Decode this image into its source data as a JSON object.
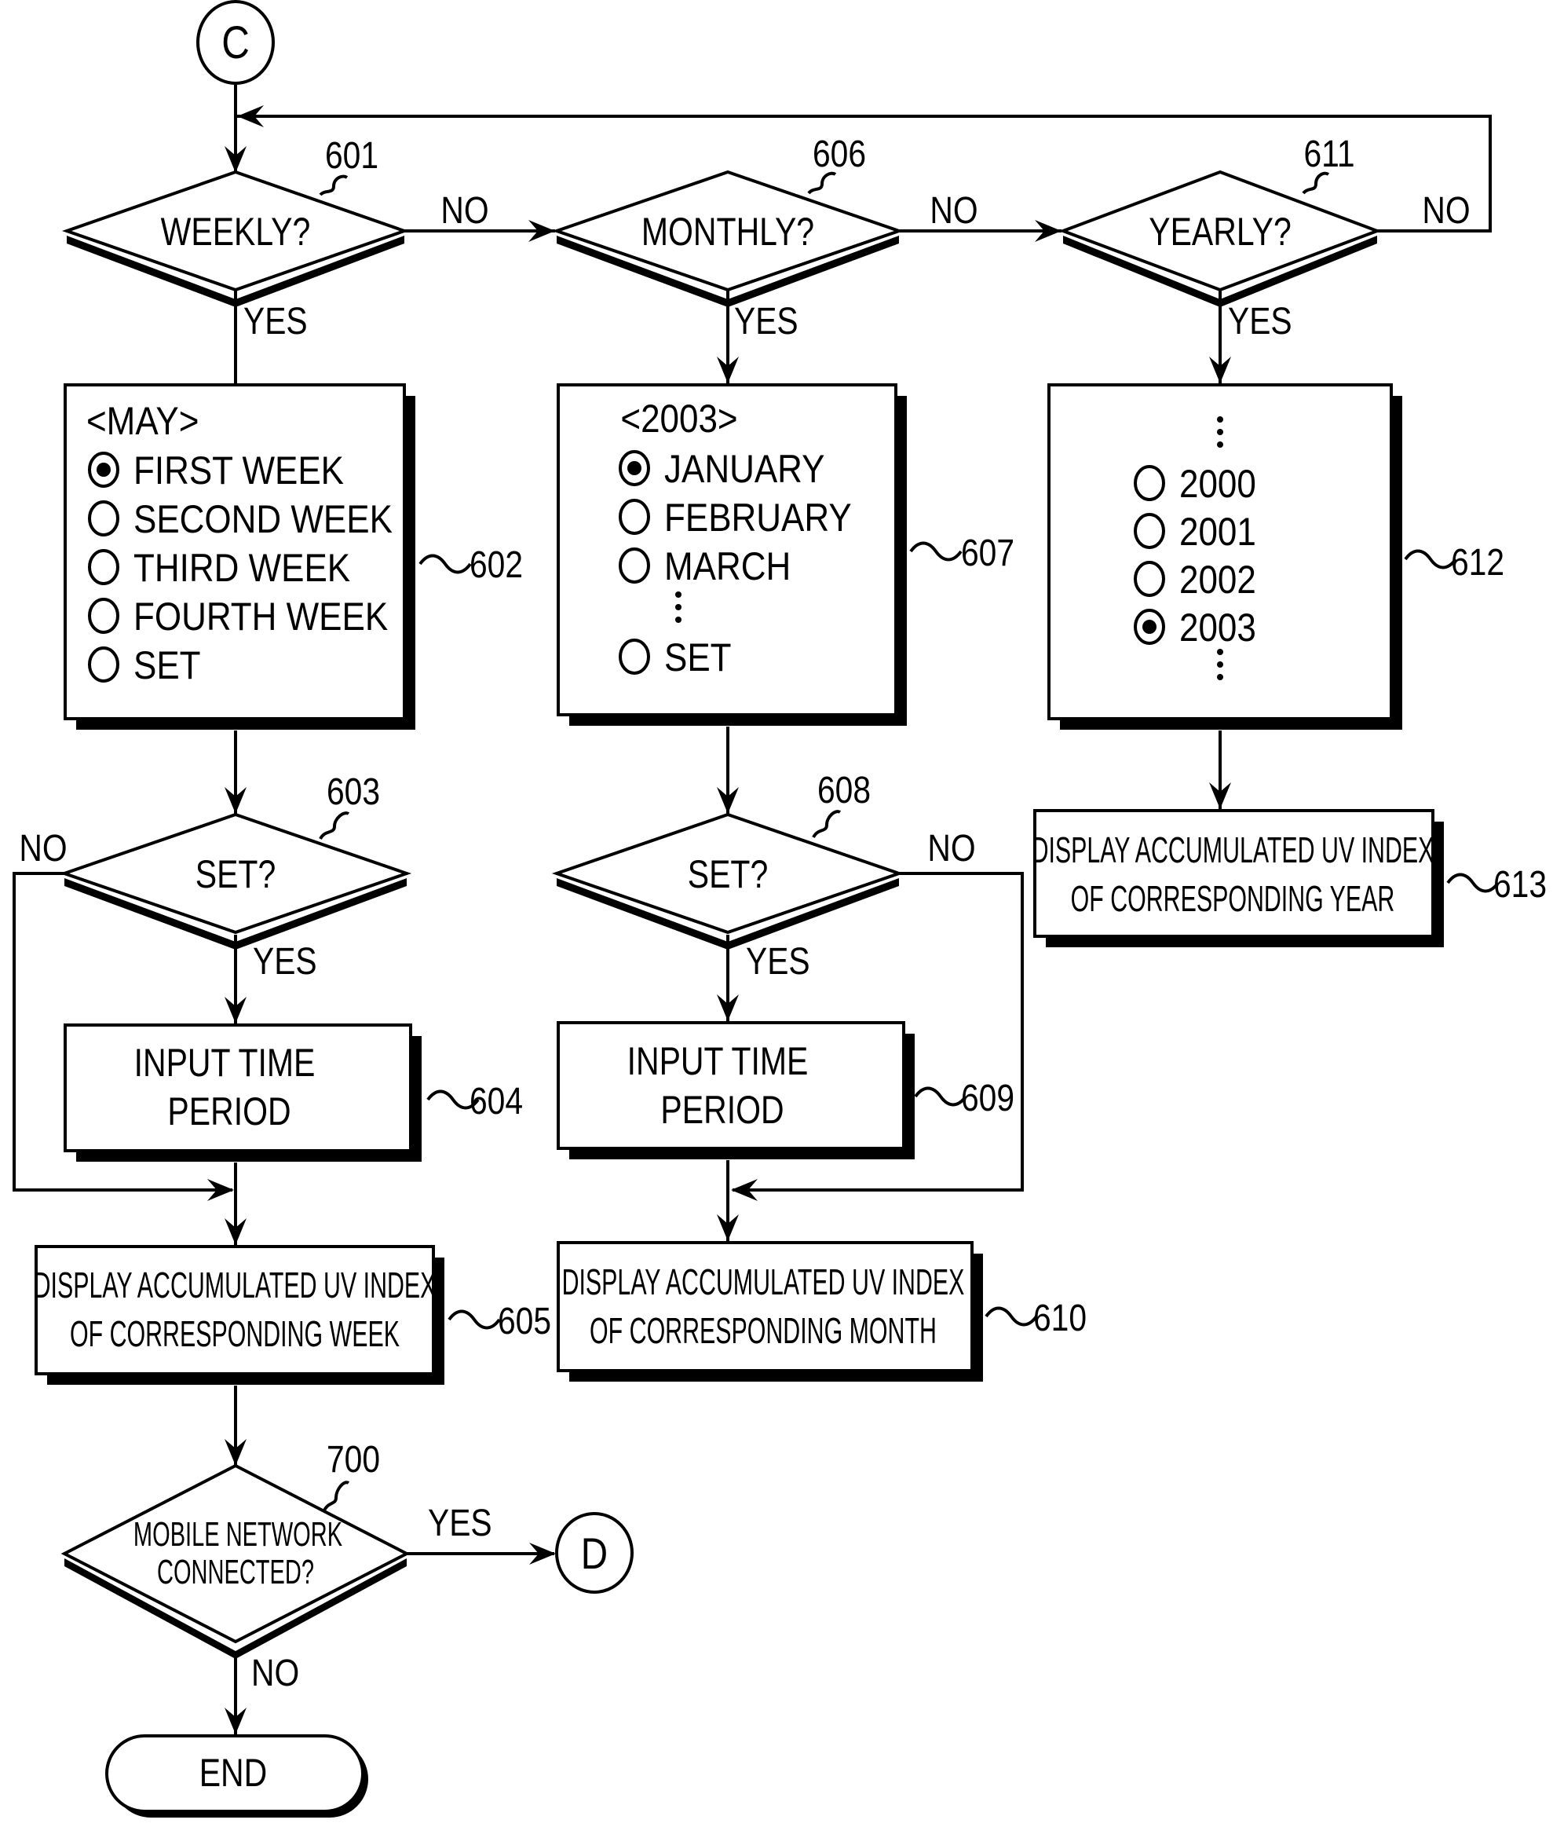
{
  "figure": {
    "connectors": {
      "start": "C",
      "exit": "D"
    },
    "decisions": {
      "weekly": {
        "ref": "601",
        "label": "WEEKLY?",
        "yes": "YES",
        "no": "NO"
      },
      "monthly": {
        "ref": "606",
        "label": "MONTHLY?",
        "yes": "YES",
        "no": "NO"
      },
      "yearly": {
        "ref": "611",
        "label": "YEARLY?",
        "yes": "YES",
        "no": "NO"
      },
      "set_week": {
        "ref": "603",
        "label": "SET?",
        "yes": "YES",
        "no": "NO"
      },
      "set_month": {
        "ref": "608",
        "label": "SET?",
        "yes": "YES",
        "no": "NO"
      },
      "mobile": {
        "ref": "700",
        "label_line1": "MOBILE NETWORK",
        "label_line2": "CONNECTED?",
        "yes": "YES",
        "no": "NO"
      }
    },
    "week_menu": {
      "ref": "602",
      "title": "<MAY>",
      "options": [
        {
          "label": "FIRST WEEK",
          "selected": true
        },
        {
          "label": "SECOND WEEK",
          "selected": false
        },
        {
          "label": "THIRD WEEK",
          "selected": false
        },
        {
          "label": "FOURTH WEEK",
          "selected": false
        },
        {
          "label": "SET",
          "selected": false
        }
      ]
    },
    "month_menu": {
      "ref": "607",
      "title": "<2003>",
      "options": [
        {
          "label": "JANUARY",
          "selected": true
        },
        {
          "label": "FEBRUARY",
          "selected": false
        },
        {
          "label": "MARCH",
          "selected": false
        },
        {
          "label": "SET",
          "selected": false
        }
      ],
      "ellipsis": "⋮"
    },
    "year_menu": {
      "ref": "612",
      "options": [
        {
          "label": "2000",
          "selected": false
        },
        {
          "label": "2001",
          "selected": false
        },
        {
          "label": "2002",
          "selected": false
        },
        {
          "label": "2003",
          "selected": true
        }
      ],
      "ellipsis": "⋮"
    },
    "processes": {
      "input_week": {
        "ref": "604",
        "line1": "INPUT TIME",
        "line2": "PERIOD"
      },
      "input_month": {
        "ref": "609",
        "line1": "INPUT TIME",
        "line2": "PERIOD"
      },
      "display_week": {
        "ref": "605",
        "line1": "DISPLAY ACCUMULATED UV INDEX",
        "line2": "OF CORRESPONDING WEEK"
      },
      "display_month": {
        "ref": "610",
        "line1": "DISPLAY ACCUMULATED UV INDEX",
        "line2": "OF CORRESPONDING MONTH"
      },
      "display_year": {
        "ref": "613",
        "line1": "DISPLAY ACCUMULATED UV INDEX",
        "line2": "OF CORRESPONDING YEAR"
      }
    },
    "terminal": {
      "label": "END"
    }
  }
}
